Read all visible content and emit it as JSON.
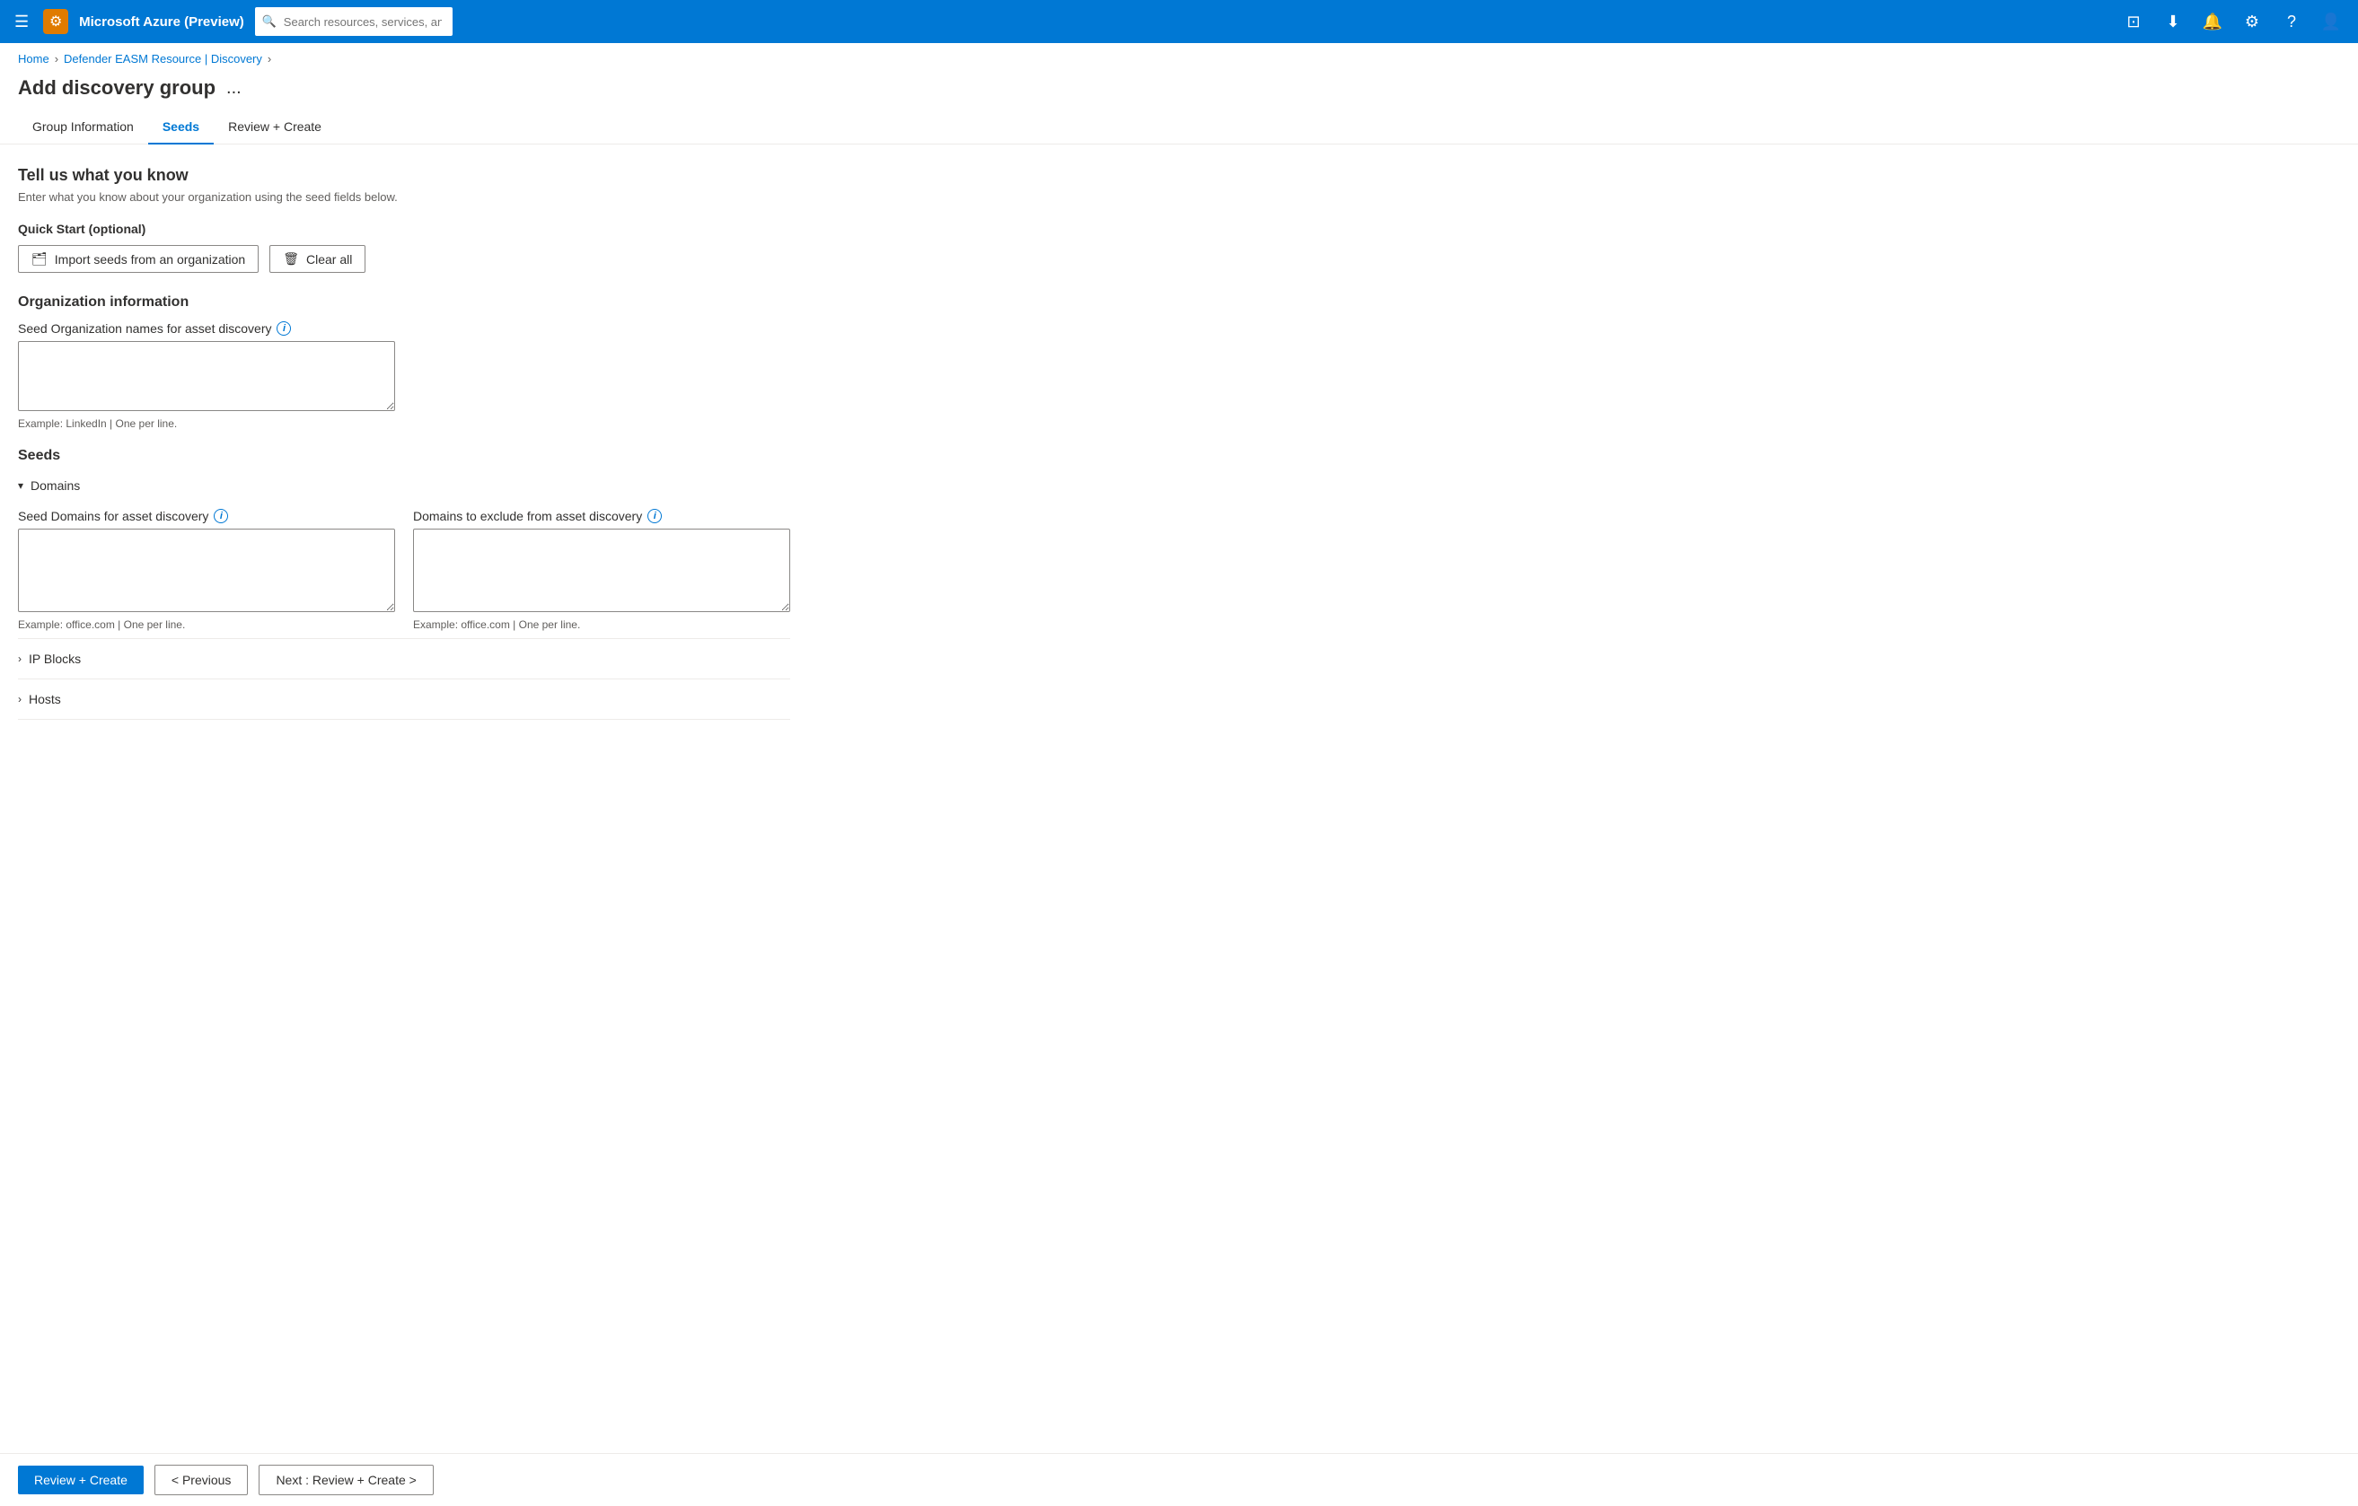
{
  "topbar": {
    "hamburger": "☰",
    "title": "Microsoft Azure (Preview)",
    "logo_icon": "⚙",
    "search_placeholder": "Search resources, services, and docs (G+/)",
    "icons": [
      "⊡",
      "⬇",
      "🔔",
      "⚙",
      "?",
      "👤"
    ]
  },
  "breadcrumb": {
    "home": "Home",
    "resource": "Defender EASM Resource | Discovery"
  },
  "header": {
    "title": "Add discovery group",
    "menu_icon": "..."
  },
  "tabs": [
    {
      "label": "Group Information",
      "active": false
    },
    {
      "label": "Seeds",
      "active": true
    },
    {
      "label": "Review + Create",
      "active": false
    }
  ],
  "main": {
    "section_title": "Tell us what you know",
    "section_subtitle": "Enter what you know about your organization using the seed fields below.",
    "quick_start_label": "Quick Start (optional)",
    "import_button_label": "Import seeds from an organization",
    "clear_all_label": "Clear all",
    "org_info_title": "Organization information",
    "org_names_label": "Seed Organization names for asset discovery",
    "org_names_hint": "Example: LinkedIn | One per line.",
    "seeds_title": "Seeds",
    "domains_section": {
      "label": "Domains",
      "expanded": true,
      "seed_domains_label": "Seed Domains for asset discovery",
      "seed_domains_hint": "Example: office.com | One per line.",
      "exclude_domains_label": "Domains to exclude from asset discovery",
      "exclude_domains_hint": "Example: office.com | One per line."
    },
    "ip_blocks_section": {
      "label": "IP Blocks",
      "expanded": false
    },
    "hosts_section": {
      "label": "Hosts",
      "expanded": false
    }
  },
  "footer": {
    "review_create_label": "Review + Create",
    "previous_label": "< Previous",
    "next_label": "Next : Review + Create >"
  }
}
